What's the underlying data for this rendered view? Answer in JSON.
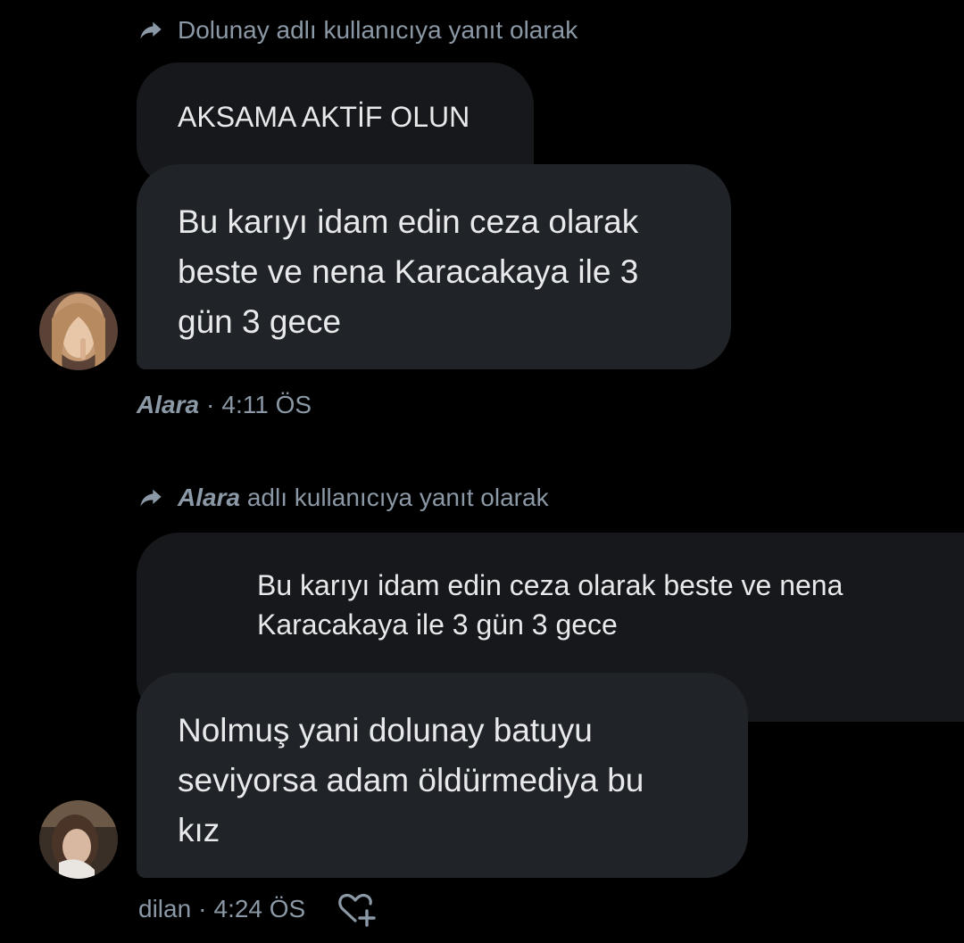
{
  "thread": {
    "group1": {
      "reply_to_name": "Dolunay",
      "reply_suffix": "adlı kullanıcıya yanıt olarak",
      "quoted_text": "AKSAMA AKTİF OLUN",
      "message_lines": [
        "Bu karıyı idam edin ceza olarak",
        "beste ve nena Karacakaya ile 3",
        "gün 3 gece"
      ],
      "sender": "Alara",
      "separator": "·",
      "time": "4:11 ÖS",
      "avatar_icon": "avatar-alara"
    },
    "group2": {
      "reply_to_name": "Alara",
      "reply_suffix": "adlı kullanıcıya yanıt olarak",
      "quoted_lines": [
        "Bu karıyı idam edin ceza olarak beste ve nena",
        "Karacakaya ile 3 gün 3 gece"
      ],
      "message_lines": [
        "Nolmuş yani dolunay batuyu",
        "seviyorsa adam öldürmediya bu",
        "kız"
      ],
      "sender": "dilan",
      "separator": "·",
      "time": "4:24 ÖS",
      "reaction_icon": "add-reaction-heart-icon",
      "avatar_icon": "avatar-dilan"
    }
  },
  "colors": {
    "background": "#000000",
    "bubble": "#202327",
    "quoted_bubble": "#16181c",
    "secondary_text": "#8b98a5",
    "primary_text": "#e7e9ea"
  }
}
